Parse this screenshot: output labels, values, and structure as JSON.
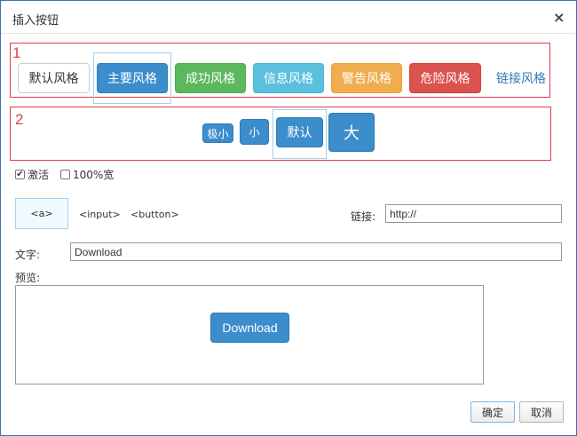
{
  "dialog": {
    "title": "插入按钮",
    "close_symbol": "×"
  },
  "row_labels": [
    "1",
    "2"
  ],
  "style_buttons": [
    {
      "label": "默认风格",
      "bg": "#ffffff",
      "fg": "#333333",
      "border": "#cccccc"
    },
    {
      "label": "主要风格",
      "bg": "#3c8dcc",
      "fg": "#ffffff",
      "border": "#3379b5"
    },
    {
      "label": "成功风格",
      "bg": "#5cb85c",
      "fg": "#ffffff",
      "border": "#4cae4c"
    },
    {
      "label": "信息风格",
      "bg": "#5bc0de",
      "fg": "#ffffff",
      "border": "#46b8da"
    },
    {
      "label": "警告风格",
      "bg": "#f0ad4e",
      "fg": "#ffffff",
      "border": "#eea236"
    },
    {
      "label": "危险风格",
      "bg": "#d9534f",
      "fg": "#ffffff",
      "border": "#d43f3a"
    },
    {
      "label": "链接风格",
      "bg": "transparent",
      "fg": "#337ab7",
      "border": "transparent"
    }
  ],
  "size_buttons": [
    "极小",
    "小",
    "默认",
    "大"
  ],
  "options": {
    "active_label": "激活",
    "active_checked": true,
    "full_width_label": "100%宽",
    "full_width_checked": false
  },
  "tag_types": [
    "<a>",
    "<input>",
    "<button>"
  ],
  "link": {
    "label": "链接:",
    "value": "http://"
  },
  "text": {
    "label": "文字:",
    "value": "Download"
  },
  "preview": {
    "label": "预览:",
    "button_label": "Download"
  },
  "footer": {
    "ok_label": "确定",
    "cancel_label": "取消"
  },
  "colors": {
    "primary": "#3c8dcc",
    "red_outline": "#e0404a",
    "selection_outline": "#9fd3ec"
  }
}
